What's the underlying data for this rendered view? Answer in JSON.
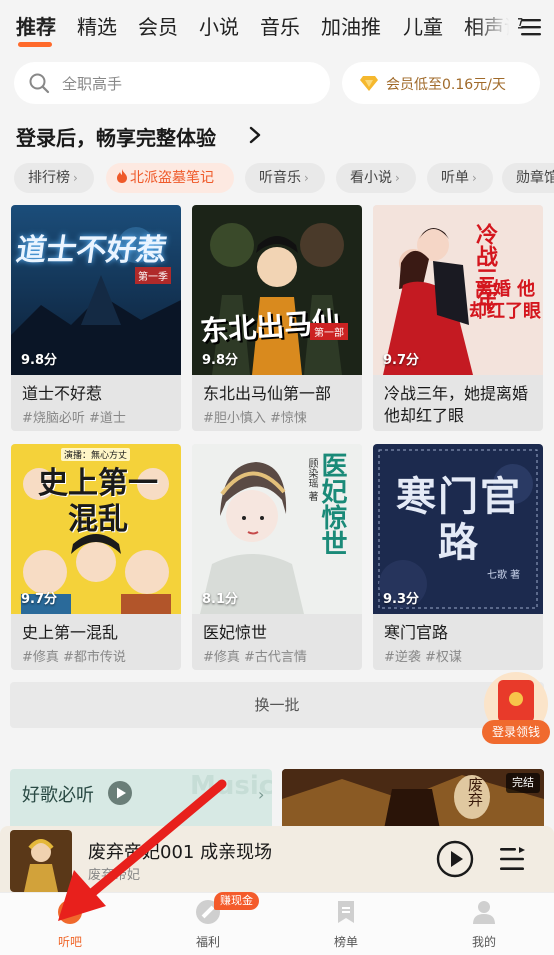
{
  "tabs": [
    {
      "label": "推荐",
      "active": true
    },
    {
      "label": "精选"
    },
    {
      "label": "会员"
    },
    {
      "label": "小说"
    },
    {
      "label": "音乐"
    },
    {
      "label": "加油推"
    },
    {
      "label": "儿童"
    },
    {
      "label": "相声评"
    }
  ],
  "search": {
    "placeholder": "全职高手",
    "icon": "search-icon"
  },
  "vip_promo": {
    "label": "会员低至0.16元/天",
    "icon": "diamond-icon"
  },
  "login_prompt": {
    "label": "登录后，畅享完整体验",
    "icon": "chevron-right-icon"
  },
  "chips": [
    {
      "label": "排行榜"
    },
    {
      "label": "北派盗墓笔记",
      "hot": true
    },
    {
      "label": "听音乐"
    },
    {
      "label": "看小说"
    },
    {
      "label": "听单"
    },
    {
      "label": "勋章馆"
    }
  ],
  "cards": [
    {
      "title": "道士不好惹",
      "score": "9.8分",
      "tags": "#烧脑必听  #道士",
      "cover_text": "道士不好惹",
      "cover_sub": "第一季"
    },
    {
      "title": "东北出马仙第一部",
      "score": "9.8分",
      "tags": "#胆小慎入  #惊悚",
      "cover_text": "东北出马仙",
      "cover_sub": "第一部"
    },
    {
      "title": "冷战三年，她提离婚他却红了眼",
      "score": "9.7分",
      "tags": "",
      "cover_text": "冷战三年",
      "cover_sub": "离婚 他却红了眼"
    },
    {
      "title": "史上第一混乱",
      "score": "9.7分",
      "tags": "#修真  #都市传说",
      "cover_text": "史上第一混乱",
      "cover_sub": "演播：無心方丈"
    },
    {
      "title": "医妃惊世",
      "score": "8.1分",
      "tags": "#修真  #古代言情",
      "cover_text": "医妃惊世",
      "cover_sub": "顾染瑶 著"
    },
    {
      "title": "寒门官路",
      "score": "9.3分",
      "tags": "#逆袭  #权谋",
      "cover_text": "寒门官路",
      "cover_sub": "七歌 著"
    }
  ],
  "refresh_label": "换一批",
  "packet_label": "登录领钱",
  "music_section": {
    "title": "好歌必听",
    "watermark": "Music"
  },
  "album_badge": "完结",
  "album_cover_text": "废弃",
  "player": {
    "title": "废弃帝妃001 成亲现场",
    "subtitle": "废弃帝妃"
  },
  "nav": [
    {
      "label": "听吧",
      "active": true,
      "icon": "leaf-icon"
    },
    {
      "label": "福利",
      "icon": "gift-icon",
      "badge": "赚现金"
    },
    {
      "label": "榜单",
      "icon": "bookmark-icon"
    },
    {
      "label": "我的",
      "icon": "user-icon"
    }
  ],
  "colors": {
    "accent": "#ff6a2b",
    "arrow": "#e8201c"
  }
}
